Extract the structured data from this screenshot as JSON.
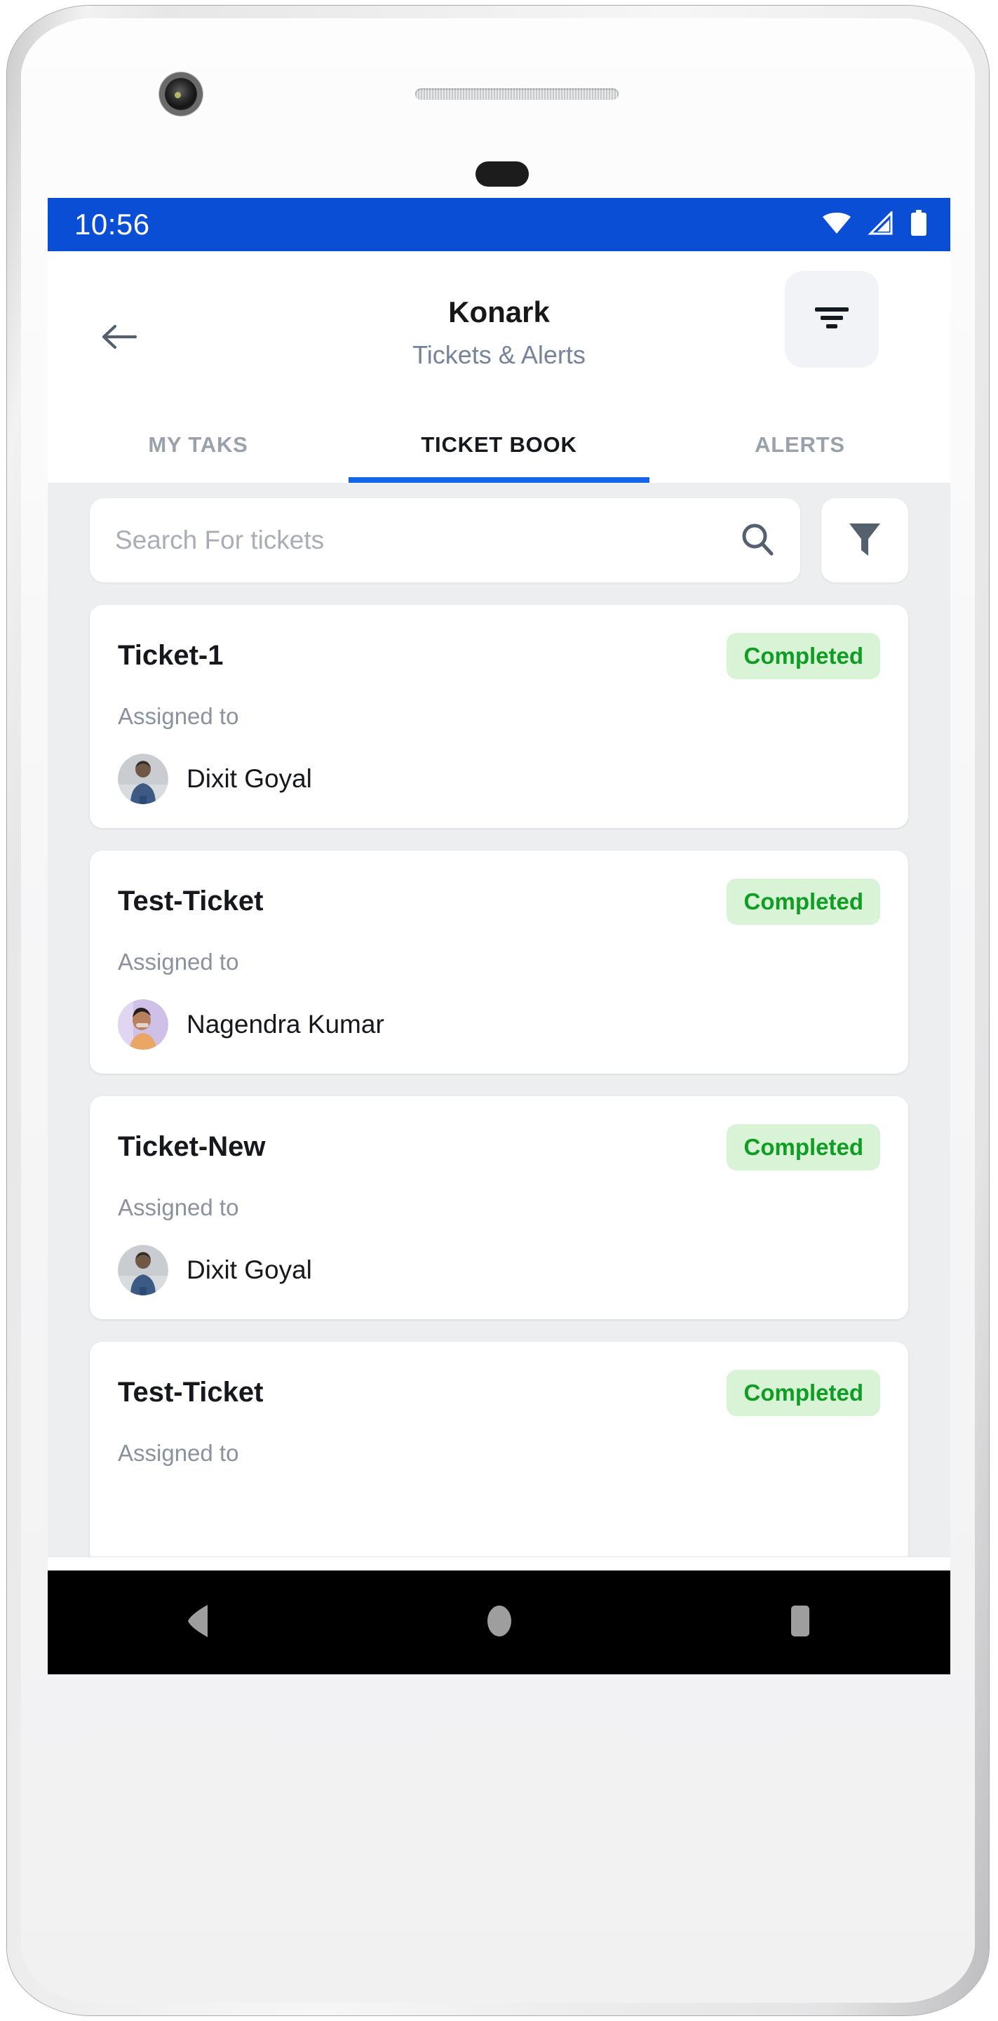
{
  "device": {
    "camera_icon": "camera-lens",
    "speaker_icon": "earpiece-speaker"
  },
  "status_bar": {
    "time": "10:56",
    "background_color": "#0B4ED6",
    "icons": [
      "wifi-icon",
      "cellular-signal-icon",
      "battery-icon"
    ]
  },
  "app_bar": {
    "back_icon": "back-arrow-icon",
    "title": "Konark",
    "subtitle": "Tickets & Alerts",
    "sort_icon": "sort-icon"
  },
  "tabs": {
    "items": [
      {
        "label": "MY TAKS",
        "active": false
      },
      {
        "label": "TICKET BOOK",
        "active": true
      },
      {
        "label": "ALERTS",
        "active": false
      }
    ],
    "active_index": 1,
    "indicator_color": "#1565e8"
  },
  "search": {
    "placeholder": "Search For tickets",
    "value": "",
    "search_icon": "search-icon",
    "filter_icon": "filter-funnel-icon"
  },
  "tickets": [
    {
      "name": "Ticket-1",
      "status": "Completed",
      "assigned_label": "Assigned to",
      "assignee": "Dixit Goyal",
      "avatar": "avatar-dixit-goyal"
    },
    {
      "name": "Test-Ticket",
      "status": "Completed",
      "assigned_label": "Assigned to",
      "assignee": "Nagendra Kumar",
      "avatar": "avatar-nagendra-kumar"
    },
    {
      "name": "Ticket-New",
      "status": "Completed",
      "assigned_label": "Assigned to",
      "assignee": "Dixit Goyal",
      "avatar": "avatar-dixit-goyal"
    },
    {
      "name": "Test-Ticket",
      "status": "Completed",
      "assigned_label": "Assigned to",
      "assignee": "",
      "avatar": ""
    }
  ],
  "status_colors": {
    "completed_text": "#0f9d23",
    "completed_background": "#d8f3d5"
  },
  "bottom_nav": {
    "items": [
      {
        "icon": "home-icon",
        "active": true
      },
      {
        "icon": "bell-icon",
        "active": false
      },
      {
        "icon": "person-icon",
        "active": false
      }
    ],
    "active_color": "#0b4ed6",
    "inactive_color": "#64748b"
  },
  "android_nav": {
    "items": [
      "back-triangle-icon",
      "home-circle-icon",
      "recents-square-icon"
    ],
    "icon_color": "#9e9e9e",
    "background_color": "#000000"
  }
}
